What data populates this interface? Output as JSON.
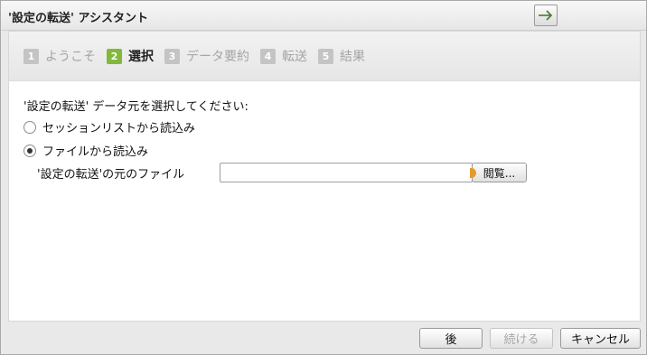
{
  "window": {
    "title": "'設定の転送' アシスタント",
    "title_button_icon": "arrow-right-icon"
  },
  "steps": [
    {
      "number": "1",
      "label": "ようこそ",
      "active": false
    },
    {
      "number": "2",
      "label": "選択",
      "active": true
    },
    {
      "number": "3",
      "label": "データ要約",
      "active": false
    },
    {
      "number": "4",
      "label": "転送",
      "active": false
    },
    {
      "number": "5",
      "label": "結果",
      "active": false
    }
  ],
  "main": {
    "prompt": "'設定の転送' データ元を選択してください:",
    "options": [
      {
        "label": "セッションリストから読込み",
        "checked": false
      },
      {
        "label": "ファイルから読込み",
        "checked": true
      }
    ],
    "file_label": "'設定の転送'の元のファイル",
    "file_value": "",
    "browse_label": "閲覧..."
  },
  "footer": {
    "back_label": "後",
    "continue_label": "続ける",
    "cancel_label": "キャンセル"
  },
  "colors": {
    "active_step": "#83b83d",
    "inactive_step": "#c4c4c4",
    "browse_accent": "#e59a2d"
  }
}
